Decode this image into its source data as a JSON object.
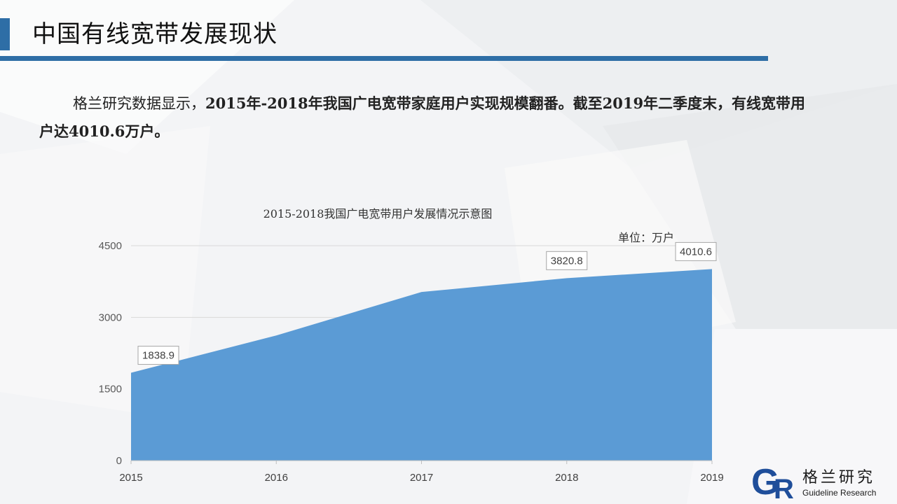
{
  "page": {
    "title": "中国有线宽带发展现状",
    "para_normal_1": "格兰研究数据显示，",
    "para_bold_1": "2015年-2018年我国广电宽带家庭用户实现规模翻番。截至2019年二季度末，有线宽带用户达4010.6万户。"
  },
  "colors": {
    "accent": "#2e6ea6",
    "area_fill": "#5b9bd5"
  },
  "chart_data": {
    "type": "area",
    "title": "2015-2018我国广电宽带用户发展情况示意图",
    "unit_label": "单位：万户",
    "x": [
      "2015",
      "2016",
      "2017",
      "2018",
      "2019"
    ],
    "series": [
      {
        "values": [
          1838.9,
          2620,
          3530,
          3820.8,
          4010.6
        ]
      }
    ],
    "data_labels": [
      {
        "index": 0,
        "text": "1838.9"
      },
      {
        "index": 3,
        "text": "3820.8"
      },
      {
        "index": 4,
        "text": "4010.6"
      }
    ],
    "yticks": [
      0,
      1500,
      3000,
      4500
    ],
    "ylim": [
      0,
      4500
    ],
    "grid": true,
    "xlabel": "",
    "ylabel": ""
  },
  "logo": {
    "mark": "GR",
    "cn": "格兰研究",
    "en": "Guideline Research"
  }
}
